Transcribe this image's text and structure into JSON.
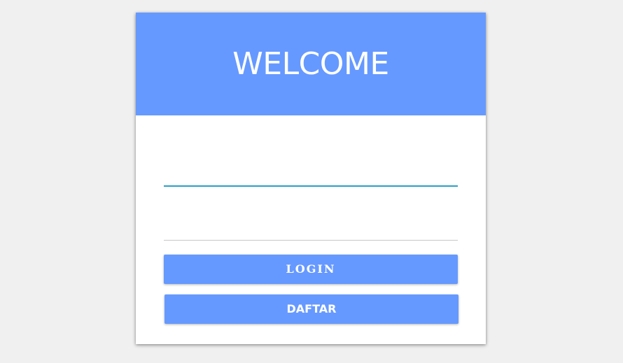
{
  "header": {
    "title": "WELCOME"
  },
  "form": {
    "username_value": "",
    "password_value": "",
    "login_label": "LOGIN",
    "daftar_label": "DAFTAR"
  },
  "colors": {
    "accent": "#6699ff",
    "field_focus_underline": "#2a9fc4",
    "field_underline": "#c8c8c8",
    "background": "#f0f0f0"
  }
}
